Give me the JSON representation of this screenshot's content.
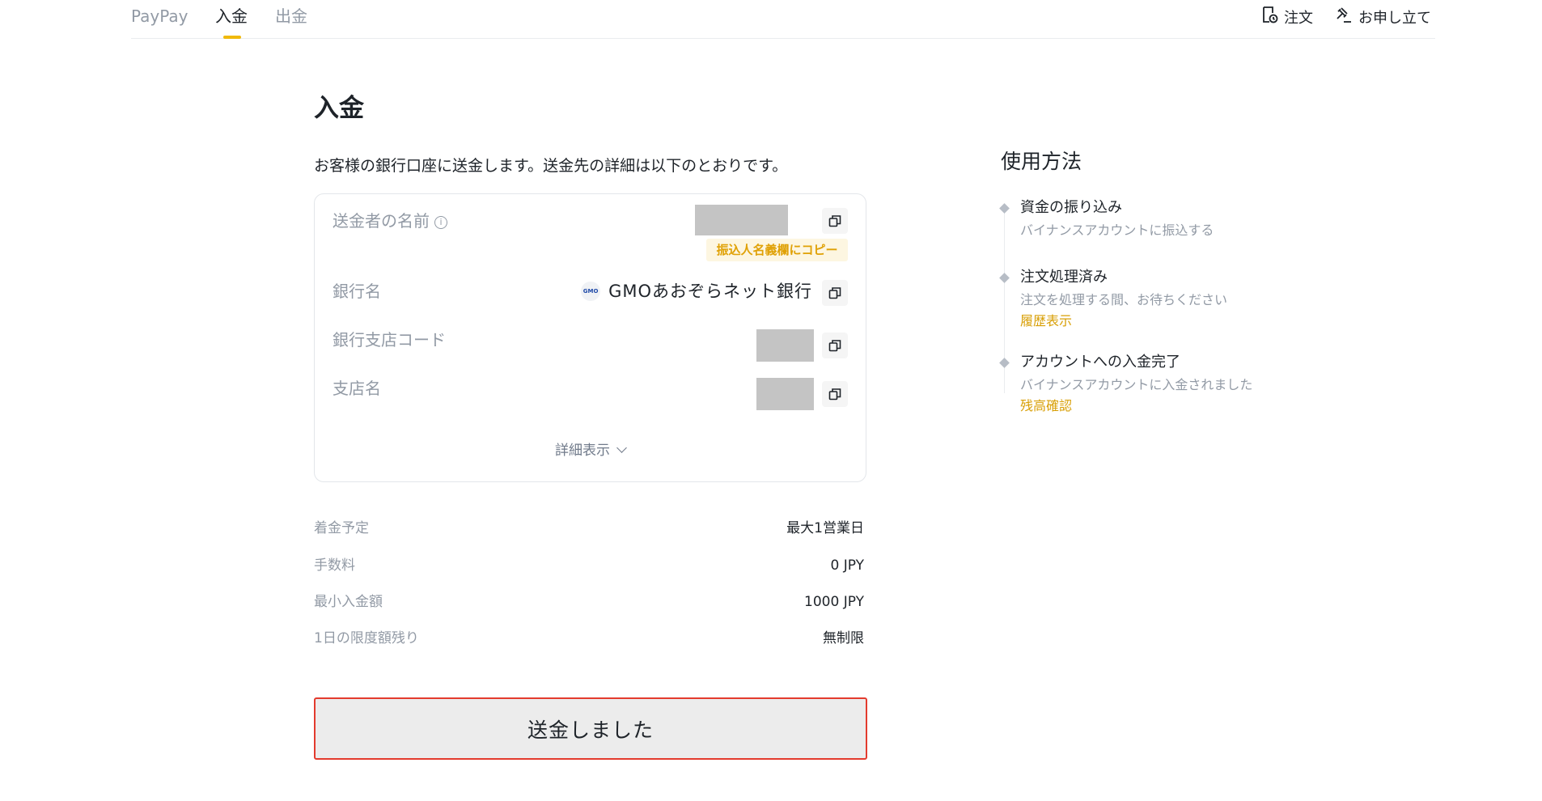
{
  "nav": {
    "tabs": [
      {
        "label": "PayPay"
      },
      {
        "label": "入金"
      },
      {
        "label": "出金"
      }
    ],
    "orders_label": "注文",
    "appeal_label": "お申し立て"
  },
  "main": {
    "title": "入金",
    "intro": "お客様の銀行口座に送金します。送金先の詳細は以下のとおりです。",
    "sender_name_label": "送金者の名前",
    "copy_to_name_field": "振込人名義欄にコピー",
    "bank_name_label": "銀行名",
    "bank_logo_text": "GMO",
    "bank_name_value": "GMOあおぞらネット銀行",
    "branch_code_label": "銀行支店コード",
    "branch_name_label": "支店名",
    "details_toggle": "詳細表示",
    "summary": [
      {
        "label": "着金予定",
        "value": "最大1営業日"
      },
      {
        "label": "手数料",
        "value": "0 JPY"
      },
      {
        "label": "最小入金額",
        "value": "1000 JPY"
      },
      {
        "label": "1日の限度額残り",
        "value": "無制限"
      }
    ],
    "submit_label": "送金しました"
  },
  "guide": {
    "title": "使用方法",
    "steps": [
      {
        "title": "資金の振り込み",
        "desc": "バイナンスアカウントに振込する",
        "link": ""
      },
      {
        "title": "注文処理済み",
        "desc": "注文を処理する間、お待ちください",
        "link": "履歴表示"
      },
      {
        "title": "アカウントへの入金完了",
        "desc": "バイナンスアカウントに入金されました",
        "link": "残高確認"
      }
    ]
  },
  "colors": {
    "accent": "#f0b90b",
    "link": "#d89f06",
    "highlight_border": "#e33b2e"
  }
}
